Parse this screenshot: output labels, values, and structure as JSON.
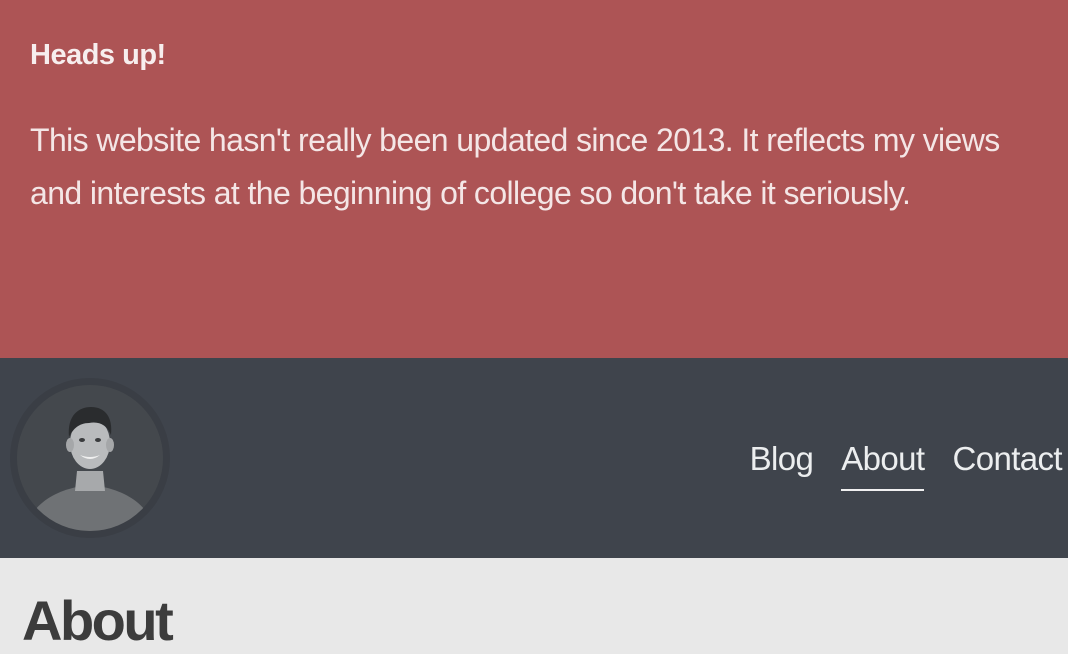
{
  "alert": {
    "heading": "Heads up!",
    "body": "This website hasn't really been updated since 2013. It reflects my views and interests at the beginning of college so don't take it seriously."
  },
  "header": {
    "avatar_icon": "profile-photo",
    "nav": [
      {
        "label": "Blog",
        "active": false
      },
      {
        "label": "About",
        "active": true
      },
      {
        "label": "Contact",
        "active": false
      }
    ]
  },
  "main": {
    "title": "About"
  },
  "colors": {
    "alert_bg": "#ad5455",
    "header_bg": "#3f444c",
    "page_bg": "#e8e8e8",
    "title_text": "#3c3c3c"
  }
}
